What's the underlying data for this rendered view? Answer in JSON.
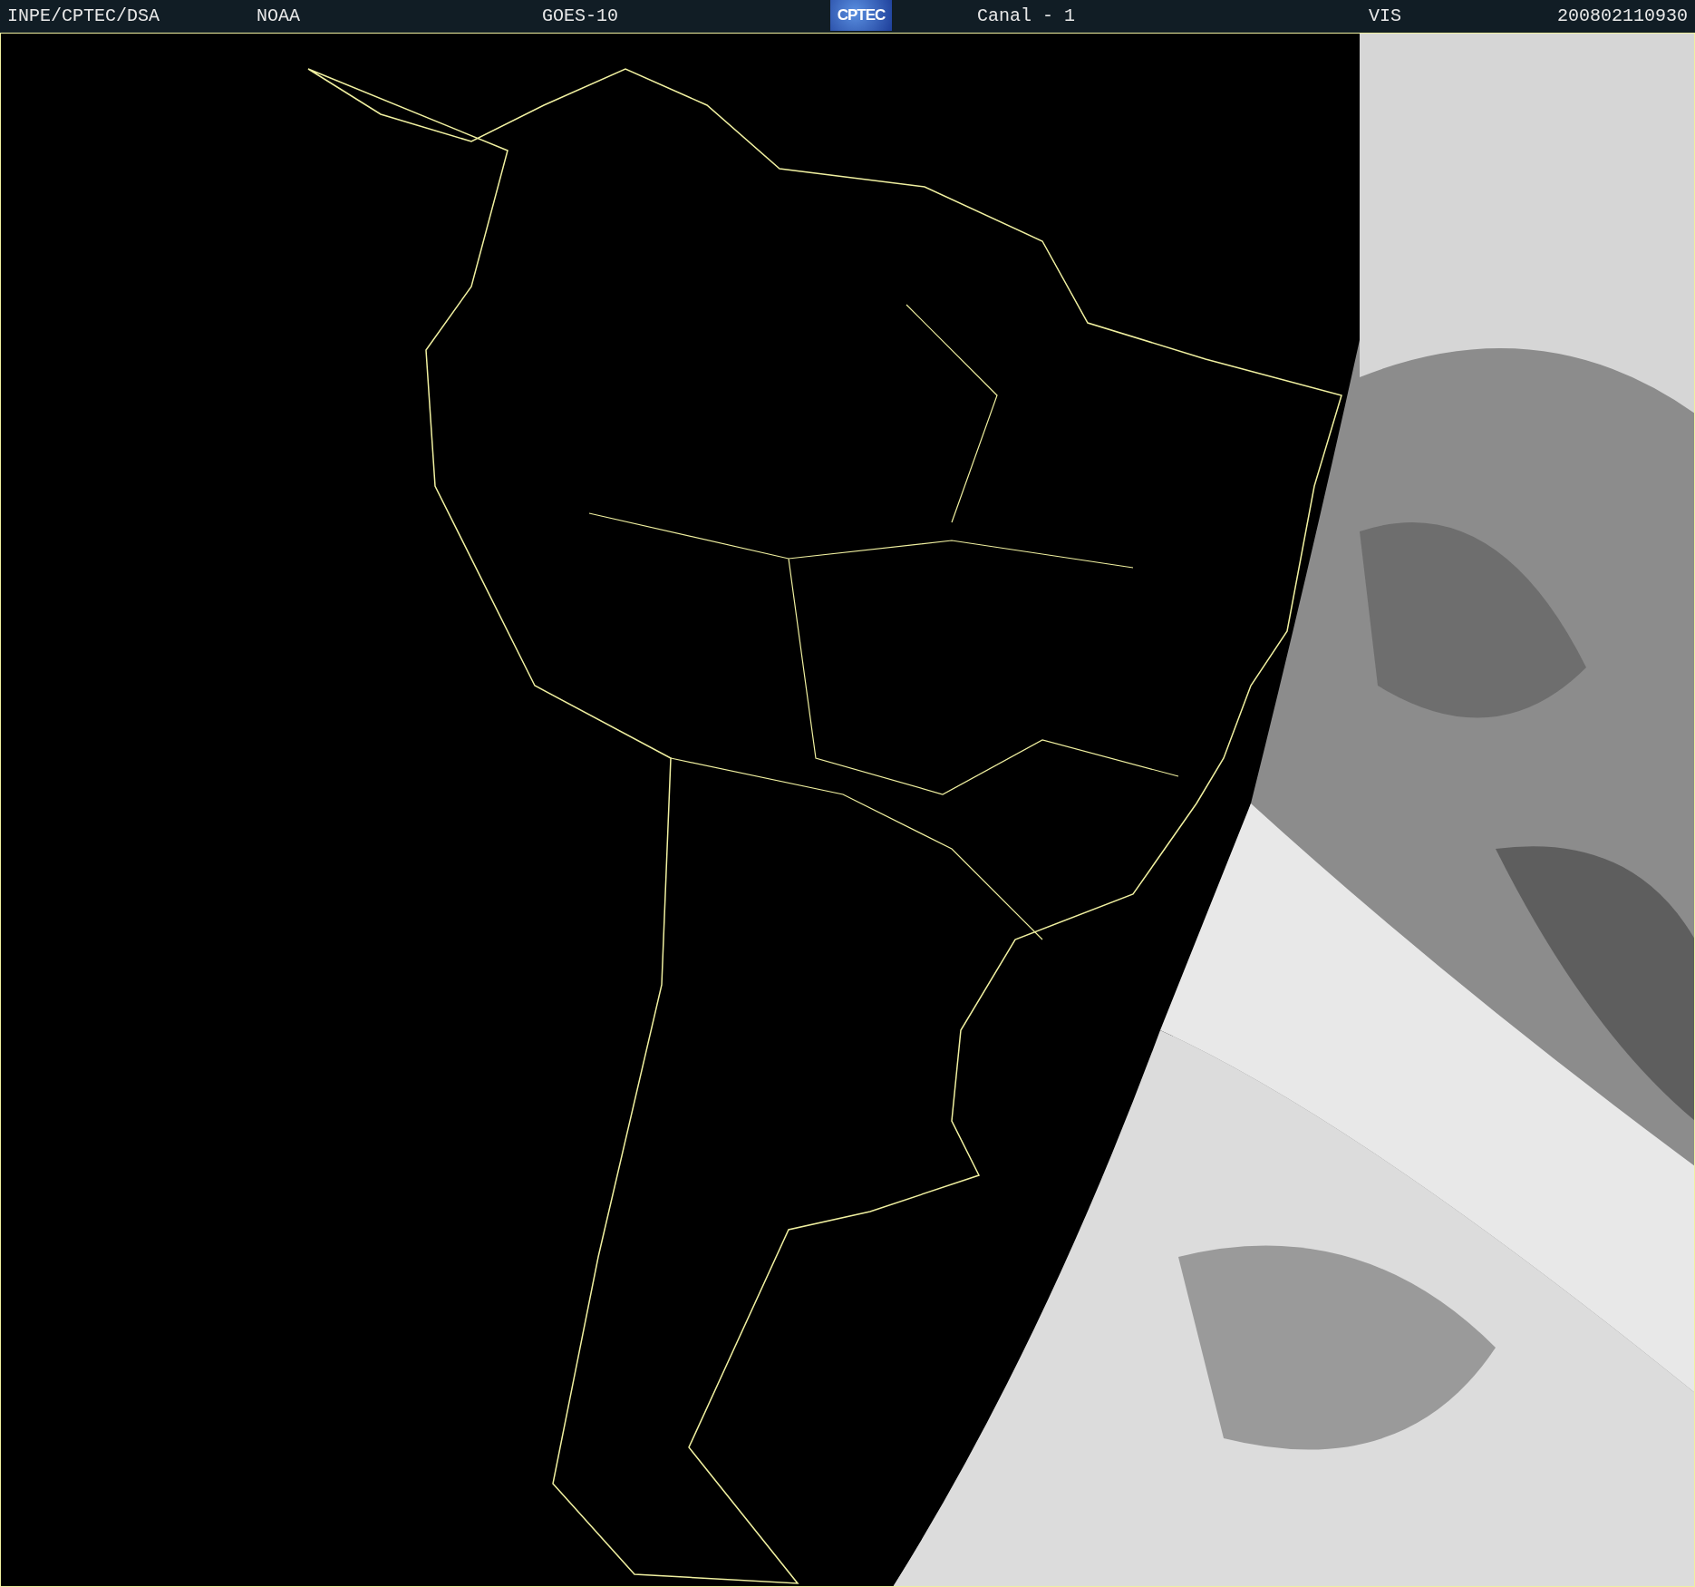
{
  "header": {
    "source": "INPE/CPTEC/DSA",
    "agency": "NOAA",
    "satellite": "GOES-10",
    "logo": "CPTEC",
    "channel": "Canal - 1",
    "band": "VIS",
    "timestamp": "200802110930"
  }
}
